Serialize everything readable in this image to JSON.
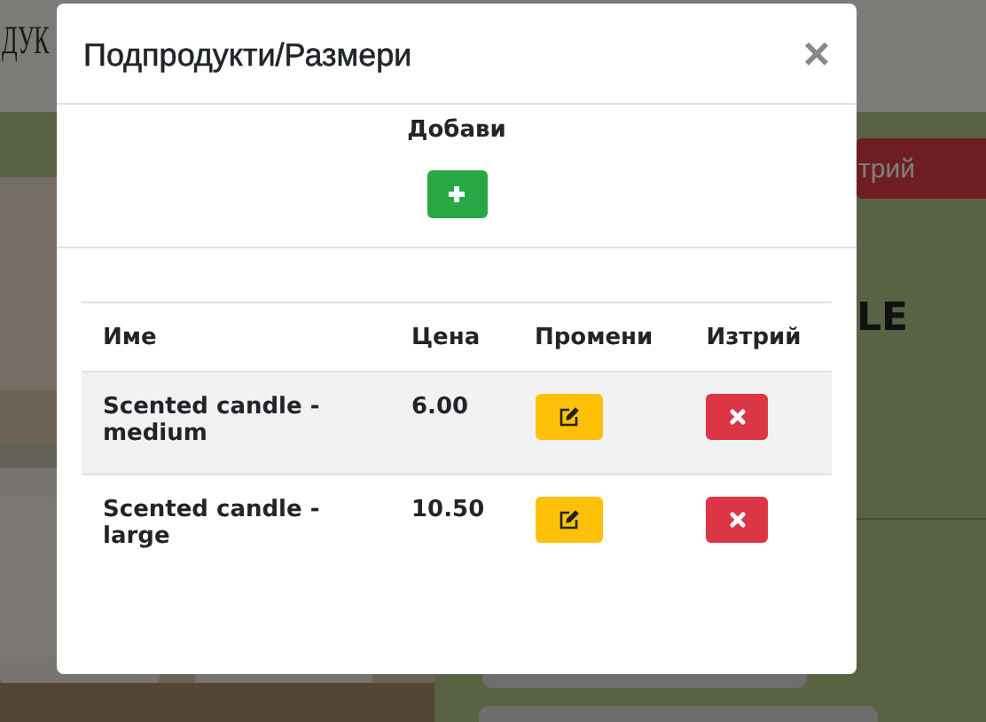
{
  "background": {
    "logo": "ДУК",
    "delete_button": "трий",
    "heading": "LE"
  },
  "modal": {
    "title": "Подпродукти/Размери",
    "close": "×",
    "add_label": "Добави",
    "table": {
      "columns": [
        "Име",
        "Цена",
        "Промени",
        "Изтрий"
      ],
      "rows": [
        {
          "name": "Scented candle - medium",
          "price": "6.00",
          "highlighted": true
        },
        {
          "name": "Scented candle - large",
          "price": "10.50",
          "highlighted": false
        }
      ]
    }
  }
}
